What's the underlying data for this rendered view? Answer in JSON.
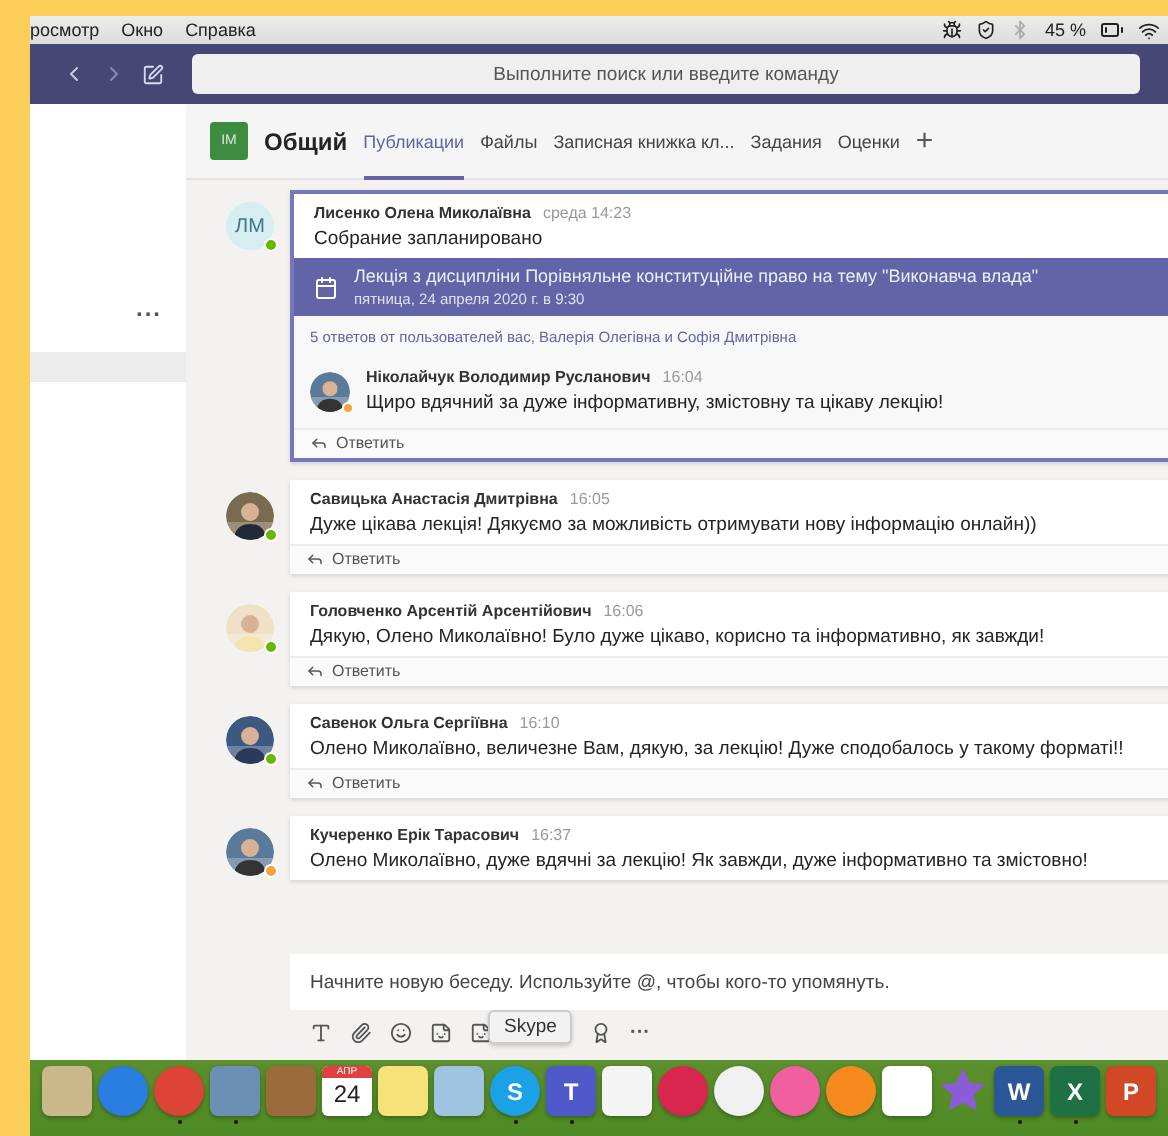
{
  "menu_bar": {
    "items": [
      "росмотр",
      "Окно",
      "Справка"
    ],
    "battery_text": "45 %"
  },
  "toolbar": {
    "search_placeholder": "Выполните поиск или введите команду"
  },
  "sidebar": {
    "more": "..."
  },
  "channel": {
    "initials": "IM",
    "name": "Общий",
    "tabs": [
      {
        "label": "Публикации",
        "selected": true
      },
      {
        "label": "Файлы",
        "selected": false
      },
      {
        "label": "Записная книжка кл...",
        "selected": false
      },
      {
        "label": "Задания",
        "selected": false
      },
      {
        "label": "Оценки",
        "selected": false
      }
    ],
    "add": "+"
  },
  "threads": [
    {
      "avatar": {
        "kind": "initials",
        "initials": "ЛМ"
      },
      "color": "#6bb700",
      "author": "Лисенко Олена Миколаївна",
      "time": "среда 14:23",
      "text": "Собрание запланировано",
      "highlighted": true,
      "meeting": {
        "title": "Лекція з дисципліни Порівняльне конституційне право на тему \"Виконавча влада\"",
        "date": "пятница, 24 апреля 2020 г. в 9:30"
      },
      "replies_summary": "5 ответов от пользователей вас, Валерія Олегівна и Софія Дмитрівна",
      "replies": [
        {
          "author": "Ніколайчук Володимир Русланович",
          "time": "16:04",
          "text": "Щиро вдячний за дуже інформативну, змістовну та цікаву лекцію!",
          "color": "#f8a33b"
        }
      ],
      "reply_label": "Ответить"
    },
    {
      "color": "#6bb700",
      "author": "Савицька Анастасія Дмитрівна",
      "time": "16:05",
      "text": "Дуже цікава лекція! Дякуємо за можливість отримувати нову інформацію онлайн))",
      "highlighted": false,
      "reply_label": "Ответить"
    },
    {
      "color": "#6bb700",
      "author": "Головченко Арсентій Арсентійович",
      "time": "16:06",
      "text": "Дякую, Олено Миколаївно! Було дуже цікаво, корисно та інформативно, як завжди!",
      "highlighted": false,
      "reply_label": "Ответить"
    },
    {
      "color": "#6bb700",
      "author": "Савенок Ольга Сергіївна",
      "time": "16:10",
      "text": "Олено Миколаївно, величезне Вам, дякую, за лекцію! Дуже сподобалось у такому форматі!!",
      "highlighted": false,
      "reply_label": "Ответить"
    },
    {
      "color": "#f8a33b",
      "author": "Кучеренко Ерік Тарасович",
      "time": "16:37",
      "text": "Олено Миколаївно, дуже вдячні за лекцію! Як завжди, дуже інформативно та змістовно!",
      "highlighted": false
    }
  ],
  "compose": {
    "placeholder": "Начните новую беседу. Используйте @, чтобы кого-то упомянуть.",
    "more": "···"
  },
  "tooltip": "Skype",
  "dock": [
    {
      "kind": "square",
      "color": "#c9b98a",
      "running": false
    },
    {
      "kind": "round",
      "color": "#2a7de1",
      "running": false
    },
    {
      "kind": "round",
      "color": "#db4437",
      "running": true
    },
    {
      "kind": "square",
      "color": "#6b8fb5",
      "running": true
    },
    {
      "kind": "square",
      "color": "#9c6b3c",
      "running": false
    },
    {
      "kind": "calendar",
      "color": "#ffffff",
      "month": "АПР",
      "day": "24",
      "running": false
    },
    {
      "kind": "square",
      "color": "#f7e27a",
      "running": false
    },
    {
      "kind": "square",
      "color": "#9fc3e0",
      "running": false
    },
    {
      "kind": "round",
      "color": "#1aa1e6",
      "glyph": "S",
      "running": true
    },
    {
      "kind": "square",
      "color": "#5059c9",
      "glyph": "T",
      "running": true
    },
    {
      "kind": "square",
      "color": "#f4f4f4",
      "running": false
    },
    {
      "kind": "round",
      "color": "#d8264f",
      "running": false
    },
    {
      "kind": "round",
      "color": "#f0f0f0",
      "running": false
    },
    {
      "kind": "round",
      "color": "#f05fa0",
      "running": false
    },
    {
      "kind": "round",
      "color": "#f58a1f",
      "running": false
    },
    {
      "kind": "square",
      "color": "#ffffff",
      "running": false
    },
    {
      "kind": "star",
      "color": "#8a5cd8",
      "running": false
    },
    {
      "kind": "square",
      "color": "#2b5797",
      "glyph": "W",
      "running": true
    },
    {
      "kind": "square",
      "color": "#1e7145",
      "glyph": "X",
      "running": true
    },
    {
      "kind": "square",
      "color": "#d24726",
      "glyph": "P",
      "running": false
    }
  ]
}
